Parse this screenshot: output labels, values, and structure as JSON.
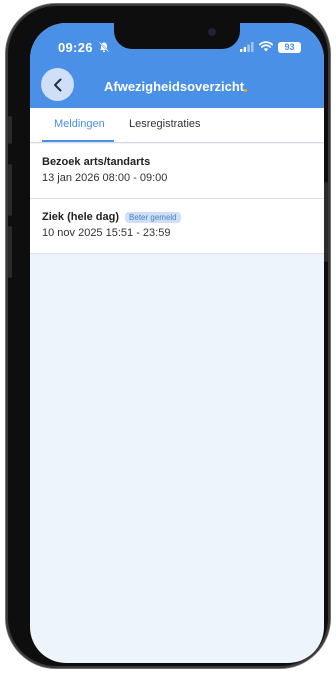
{
  "status_bar": {
    "time": "09:26",
    "battery": "93"
  },
  "header": {
    "title": "Afwezigheidsoverzicht",
    "color": "#4a90e6"
  },
  "tabs": [
    {
      "label": "Meldingen",
      "active": true
    },
    {
      "label": "Lesregistraties",
      "active": false
    }
  ],
  "items": [
    {
      "title": "Bezoek arts/tandarts",
      "badge": "",
      "subtitle": "13 jan 2026 08:00 - 09:00"
    },
    {
      "title": "Ziek (hele dag)",
      "badge": "Beter gemeld",
      "subtitle": "10 nov 2025 15:51 - 23:59"
    }
  ],
  "icons": {
    "back": "chevron-left-icon",
    "bell": "bell-slash-icon",
    "signal": "cellular-signal-icon",
    "wifi": "wifi-icon"
  }
}
